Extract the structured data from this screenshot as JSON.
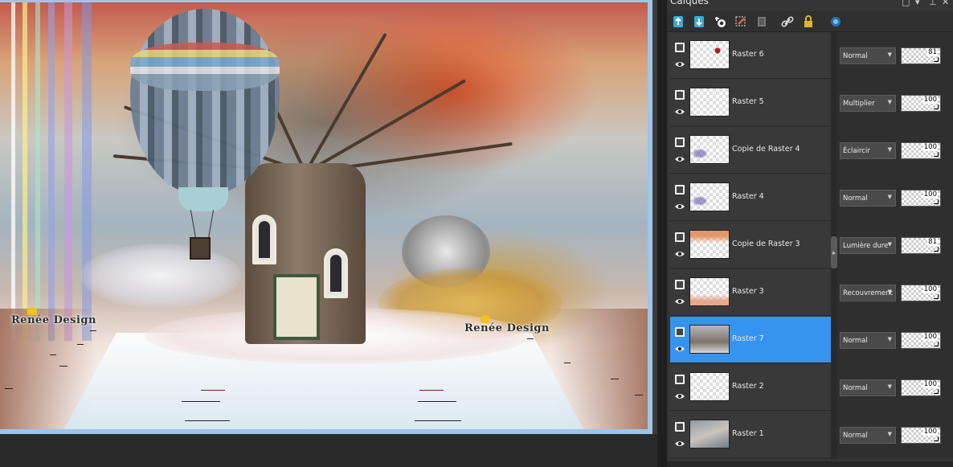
{
  "panel": {
    "title": "Calques",
    "controls": [
      "□",
      "▾",
      "⊥",
      "✕"
    ]
  },
  "toolbar": {
    "tools": [
      {
        "icon": "new-raster-layer-icon"
      },
      {
        "icon": "new-vector-layer-icon"
      },
      {
        "icon": "mask-icon"
      },
      {
        "icon": "edit-selection-icon"
      },
      {
        "icon": "delete-layer-icon"
      },
      {
        "icon": "link-icon"
      },
      {
        "icon": "lock-icon"
      },
      {
        "icon": "properties-icon"
      }
    ]
  },
  "layers": [
    {
      "name": "Raster 6",
      "blend": "Normal",
      "opacity": "81",
      "selected": false
    },
    {
      "name": "Raster 5",
      "blend": "Multiplier",
      "opacity": "100",
      "selected": false
    },
    {
      "name": "Copie de Raster 4",
      "blend": "Éclaircir",
      "opacity": "100",
      "selected": false
    },
    {
      "name": "Raster 4",
      "blend": "Normal",
      "opacity": "100",
      "selected": false
    },
    {
      "name": "Copie de Raster 3",
      "blend": "Lumière dure",
      "opacity": "81",
      "selected": false
    },
    {
      "name": "Raster 3",
      "blend": "Recouvrement",
      "opacity": "100",
      "selected": false
    },
    {
      "name": "Raster 7",
      "blend": "Normal",
      "opacity": "100",
      "selected": true
    },
    {
      "name": "Raster 2",
      "blend": "Normal",
      "opacity": "100",
      "selected": false
    },
    {
      "name": "Raster 1",
      "blend": "Normal",
      "opacity": "100",
      "selected": false
    }
  ],
  "canvas": {
    "watermark_left": "Renée Design",
    "watermark_right": "Renée Design"
  },
  "colors": {
    "selected_row": "#3793f0",
    "panel_bg": "#353535",
    "frame": "#9fc4e6"
  }
}
